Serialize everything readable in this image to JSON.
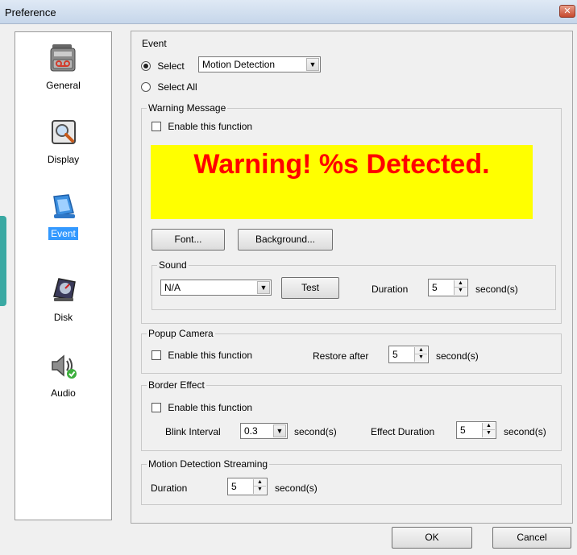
{
  "window": {
    "title": "Preference",
    "close_glyph": "✕"
  },
  "sidebar": {
    "items": [
      {
        "label": "General",
        "icon": "cassette-recorder-icon"
      },
      {
        "label": "Display",
        "icon": "magnifier-icon"
      },
      {
        "label": "Event",
        "icon": "monitor-event-icon"
      },
      {
        "label": "Disk",
        "icon": "disk-gauge-icon"
      },
      {
        "label": "Audio",
        "icon": "speaker-icon"
      }
    ],
    "active": "Event"
  },
  "event": {
    "group_title": "Event",
    "select_label": "Select",
    "select_value": "Motion Detection",
    "select_all_label": "Select All",
    "mode": "Select"
  },
  "warning": {
    "group_title": "Warning Message",
    "enable_label": "Enable this function",
    "enabled": false,
    "preview_text": "Warning! %s Detected.",
    "preview_bg": "#ffff00",
    "preview_color": "#ff0000",
    "font_button": "Font...",
    "background_button": "Background..."
  },
  "sound": {
    "group_title": "Sound",
    "value": "N/A",
    "test_button": "Test",
    "duration_label": "Duration",
    "duration_value": "5",
    "unit": "second(s)"
  },
  "popup": {
    "group_title": "Popup Camera",
    "enable_label": "Enable this function",
    "enabled": false,
    "restore_label": "Restore after",
    "restore_value": "5",
    "unit": "second(s)"
  },
  "border": {
    "group_title": "Border Effect",
    "enable_label": "Enable this function",
    "enabled": false,
    "blink_label": "Blink Interval",
    "blink_value": "0.3",
    "blink_unit": "second(s)",
    "effect_label": "Effect Duration",
    "effect_value": "5",
    "effect_unit": "second(s)"
  },
  "streaming": {
    "group_title": "Motion Detection Streaming",
    "duration_label": "Duration",
    "duration_value": "5",
    "unit": "second(s)"
  },
  "footer": {
    "ok_label": "OK",
    "cancel_label": "Cancel"
  }
}
